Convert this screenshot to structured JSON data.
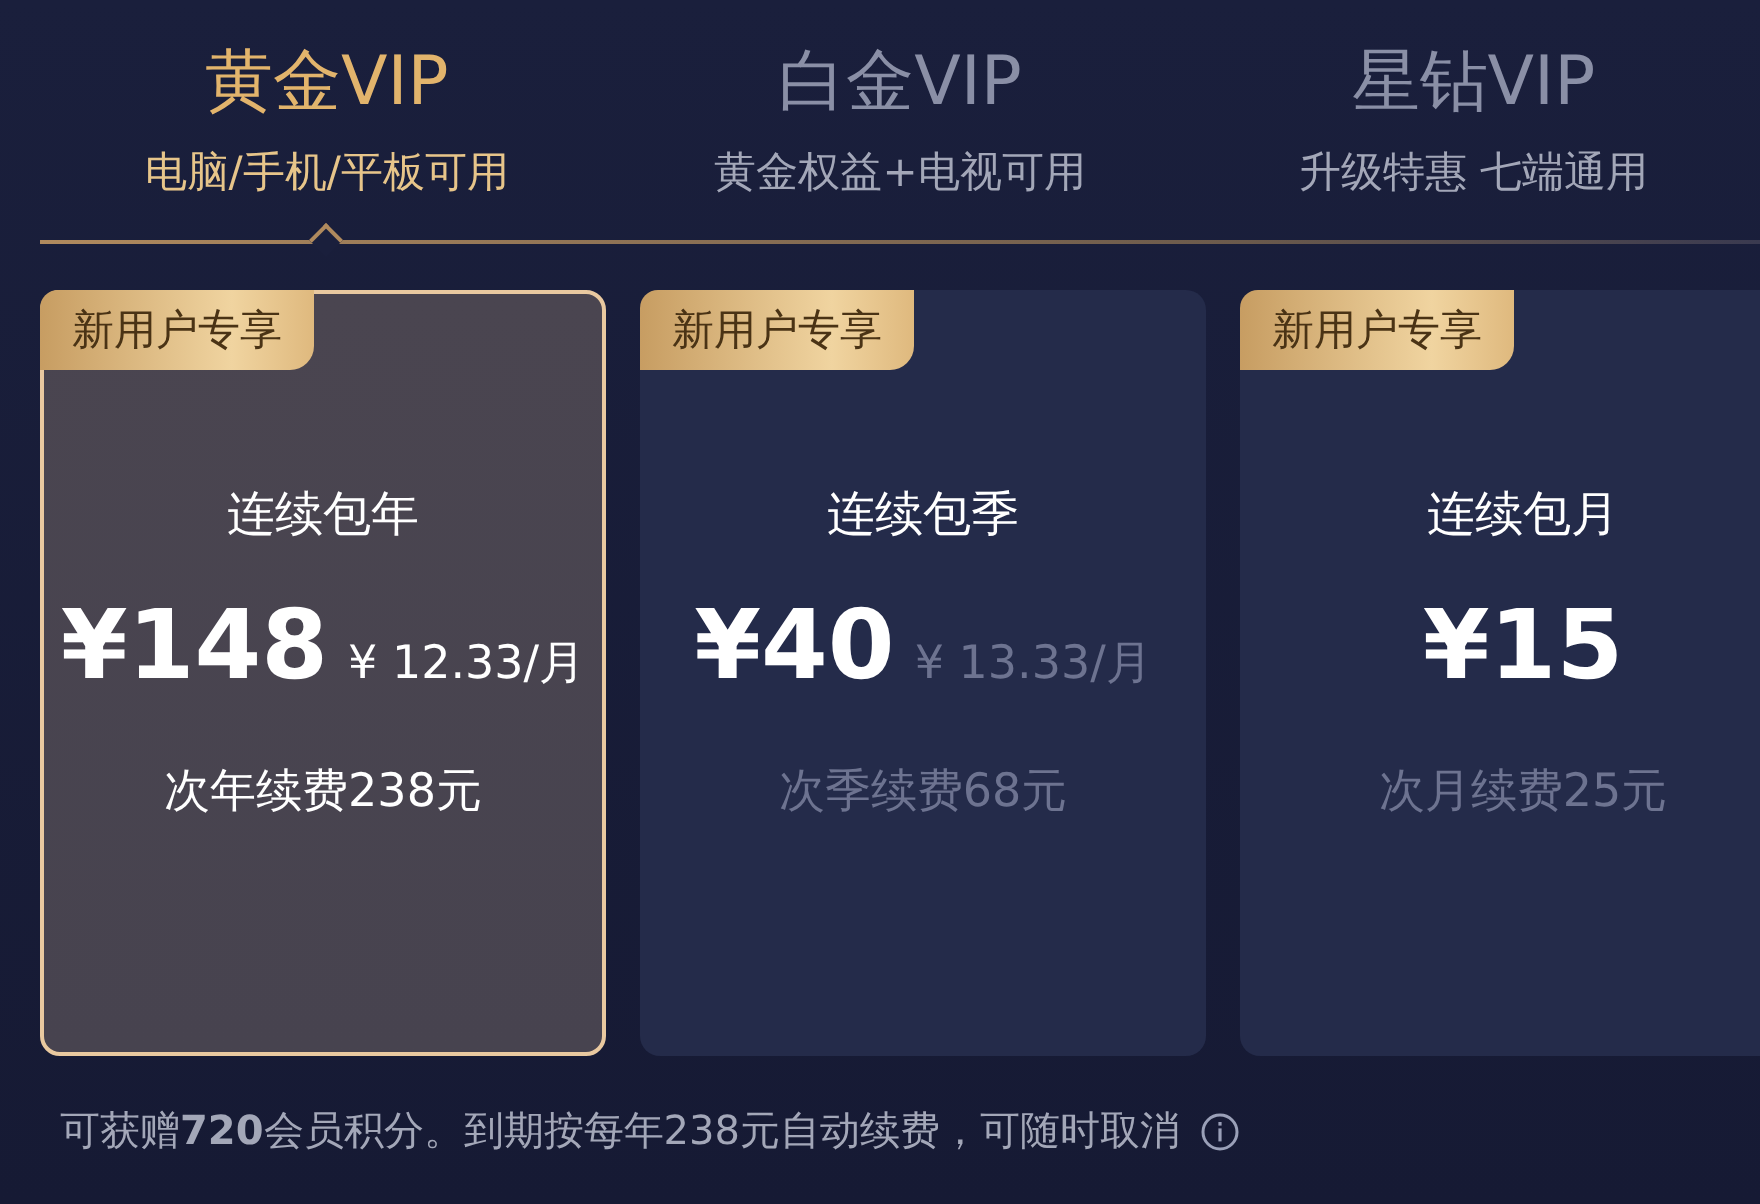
{
  "tabs": [
    {
      "title": "黄金VIP",
      "subtitle": "电脑/手机/平板可用",
      "selected": true
    },
    {
      "title": "白金VIP",
      "subtitle": "黄金权益+电视可用",
      "selected": false
    },
    {
      "title": "星钻VIP",
      "subtitle": "升级特惠 七端通用",
      "selected": false
    }
  ],
  "plans": [
    {
      "badge": "新用户专享",
      "name": "连续包年",
      "price": "¥148",
      "per_month": "¥ 12.33/月",
      "renewal": "次年续费238元",
      "selected": true
    },
    {
      "badge": "新用户专享",
      "name": "连续包季",
      "price": "¥40",
      "per_month": "¥ 13.33/月",
      "renewal": "次季续费68元",
      "selected": false
    },
    {
      "badge": "新用户专享",
      "name": "连续包月",
      "price": "¥15",
      "renewal": "次月续费25元",
      "selected": false
    }
  ],
  "footer": {
    "note": "可获赠**720**会员积分。到期按每年238元自动续费，可随时取消"
  }
}
